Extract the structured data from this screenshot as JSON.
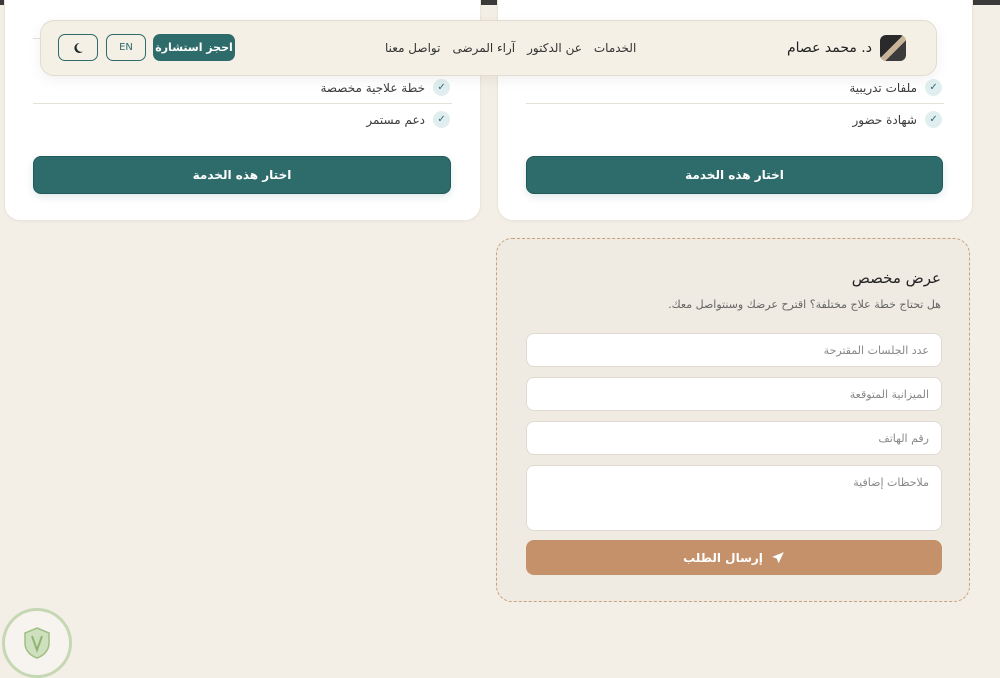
{
  "header": {
    "brand_name": "د. محمد عصام",
    "nav_links": [
      "الخدمات",
      "عن الدكتور",
      "آراء المرضى",
      "تواصل معنا"
    ],
    "book_button": "احجز استشارة",
    "lang_button": "EN"
  },
  "cards": [
    {
      "features": [
        "خطة علاجية مخصصة",
        "دعم مستمر"
      ],
      "button": "اختار هذه الخدمة"
    },
    {
      "features": [
        "ملفات تدريبية",
        "شهادة حضور"
      ],
      "button": "اختار هذه الخدمة"
    }
  ],
  "custom_offer": {
    "title": "عرض مخصص",
    "subtitle": "هل تحتاج خطة علاج مختلفة؟ اقترح عرضك وسنتواصل معك.",
    "sessions_placeholder": "عدد الجلسات المقترحة",
    "budget_placeholder": "الميزانية المتوقعة",
    "phone_placeholder": "رقم الهاتف",
    "notes_placeholder": "ملاحظات إضافية",
    "submit_label": "إرسال الطلب"
  },
  "colors": {
    "primary": "#2e6b6b",
    "accent": "#c4916a",
    "background": "#f3efe7"
  },
  "icons": [
    "check-icon",
    "moon-icon",
    "send-icon"
  ]
}
